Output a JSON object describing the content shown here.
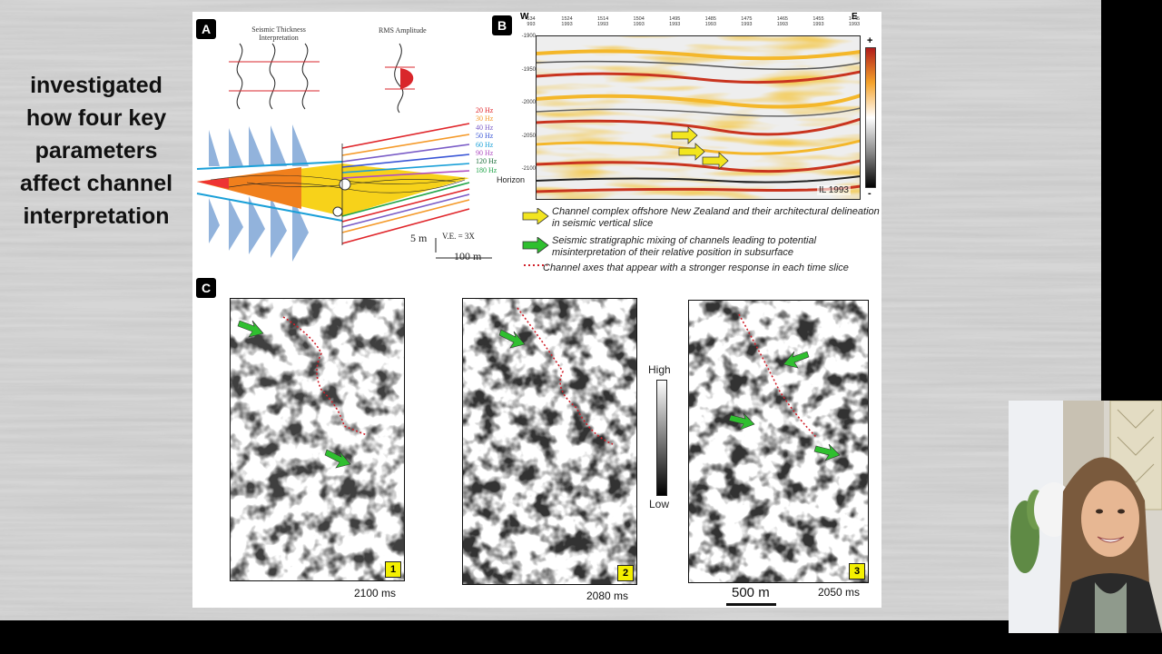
{
  "side_text": [
    "investigated",
    "how four key",
    "parameters",
    "affect channel",
    "interpretation"
  ],
  "panel_a": {
    "tag": "A",
    "heading_left": "Seismic Thickness\nInterpretation",
    "heading_left_1": "Seismic Thickness",
    "heading_left_2": "Interpretation",
    "heading_right": "RMS Amplitude",
    "frequencies": [
      "20 Hz",
      "30 Hz",
      "40 Hz",
      "50 Hz",
      "60 Hz",
      "90 Hz",
      "120 Hz",
      "180 Hz"
    ],
    "frequency_colors": [
      "#e0262b",
      "#f59a2a",
      "#7a5cc7",
      "#3a56d6",
      "#1aa0d8",
      "#b04fc2",
      "#1c6e3a",
      "#22a64b"
    ],
    "scale_vertical": "5 m",
    "scale_ve": "V.E. = 3X",
    "scale_horizontal": "100 m"
  },
  "panel_b": {
    "tag": "B",
    "west_label": "W",
    "east_label": "E",
    "top_ticks": [
      [
        "534",
        "993"
      ],
      [
        "1524",
        "1993"
      ],
      [
        "1514",
        "1993"
      ],
      [
        "1504",
        "1993"
      ],
      [
        "1495",
        "1993"
      ],
      [
        "1485",
        "1993"
      ],
      [
        "1475",
        "1993"
      ],
      [
        "1465",
        "1993"
      ],
      [
        "1455",
        "1993"
      ],
      [
        "1445",
        "1993"
      ]
    ],
    "depth_ticks": [
      "-1900",
      "-1950",
      "-2000",
      "-2050",
      "-2100"
    ],
    "horizon_label": "Horizon",
    "il_label": "IL 1993",
    "colorbar_plus": "+",
    "colorbar_minus": "-"
  },
  "legend": [
    {
      "icon": "yellow-arrow-icon",
      "text": "Channel complex offshore New Zealand and their architectural delineation in seismic vertical slice"
    },
    {
      "icon": "green-arrow-icon",
      "text": "Seismic stratigraphic mixing of channels leading to potential misinterpretation of their relative position in subsurface"
    },
    {
      "icon": "red-dotted-line-icon",
      "text": "Channel axes that appear with a stronger response in each time slice"
    }
  ],
  "panel_c": {
    "tag": "C",
    "slices": [
      {
        "num": "1",
        "time": "2100 ms"
      },
      {
        "num": "2",
        "time": "2080 ms"
      },
      {
        "num": "3",
        "time": "2050 ms"
      }
    ],
    "colorbar_high": "High",
    "colorbar_low": "Low",
    "scale_label": "500 m"
  },
  "colors": {
    "arrow_yellow": "#f2e51f",
    "arrow_green": "#2fbf2f",
    "channel_red": "#d0202a"
  }
}
